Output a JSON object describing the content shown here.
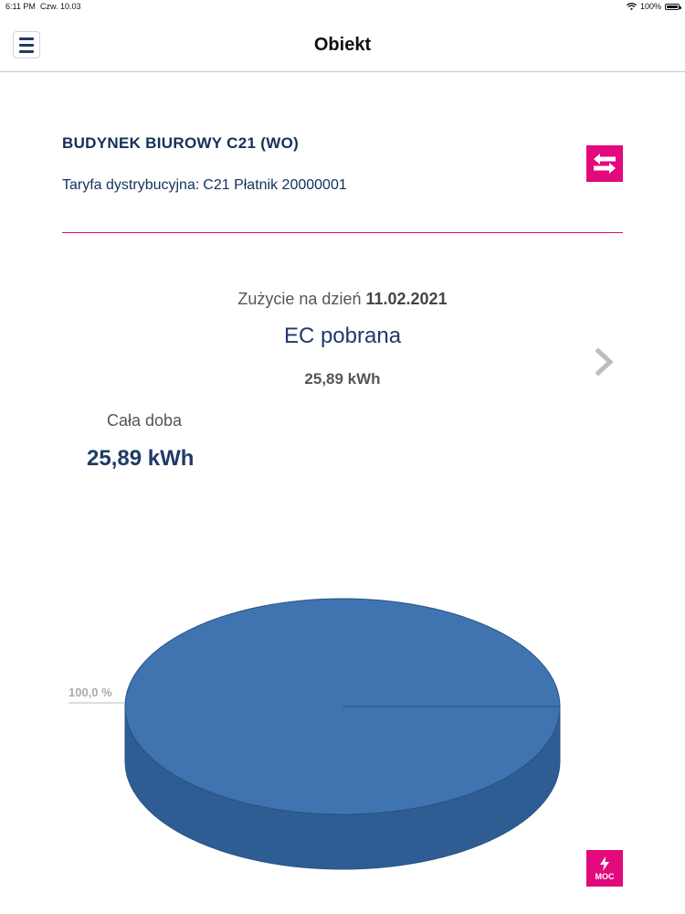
{
  "status_bar": {
    "time": "6:11 PM",
    "date": "Czw. 10.03",
    "battery": "100%",
    "icons": [
      "wifi-icon",
      "battery-icon"
    ]
  },
  "nav": {
    "title": "Obiekt",
    "menu_icon": "hamburger-icon"
  },
  "object": {
    "name": "BUDYNEK BIUROWY C21 (WO)",
    "tariff_label": "Taryfa dystrybucyjna:",
    "tariff_value": "C21 Płatnik 20000001",
    "switch_icon": "swap-arrows-icon"
  },
  "usage": {
    "date_prefix": "Zużycie na dzień",
    "date": "11.02.2021",
    "energy_type": "EC pobrana",
    "total": "25,89 kWh",
    "next_icon": "chevron-right-icon"
  },
  "zone": {
    "label": "Cała doba",
    "value": "25,89 kWh"
  },
  "chart_data": {
    "type": "pie",
    "categories": [
      "Cała doba"
    ],
    "values": [
      100.0
    ],
    "labels": [
      "100,0 %"
    ]
  },
  "moc_button": {
    "label": "MOC",
    "icon": "lightning-icon"
  },
  "colors": {
    "accent": "#e2097d",
    "navy": "#14305c",
    "pie_top": "#3f74b0",
    "pie_side": "#2e5d93"
  }
}
